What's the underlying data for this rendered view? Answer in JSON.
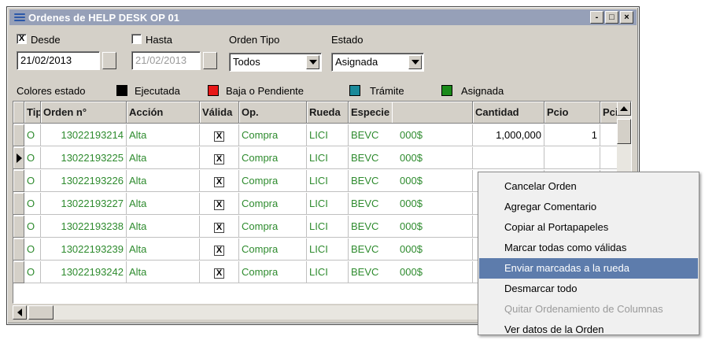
{
  "window": {
    "title": "Ordenes de HELP DESK OP 01",
    "icon": "stack-icon",
    "controls": [
      "-",
      "□",
      "×"
    ]
  },
  "filters": {
    "desde": {
      "label": "Desde",
      "checked": true,
      "check_mark": "X",
      "value": "21/02/2013"
    },
    "hasta": {
      "label": "Hasta",
      "checked": false,
      "value": "21/02/2013"
    },
    "orden_tipo": {
      "label": "Orden Tipo",
      "value": "Todos"
    },
    "estado": {
      "label": "Estado",
      "value": "Asignada"
    }
  },
  "legend": {
    "title": "Colores estado",
    "items": [
      {
        "label": "Ejecutada",
        "color": "#000000"
      },
      {
        "label": "Baja o Pendiente",
        "color": "#e81818"
      },
      {
        "label": "Trámite",
        "color": "#1a8a9a"
      },
      {
        "label": "Asignada",
        "color": "#1a8a1a"
      }
    ]
  },
  "grid": {
    "columns": [
      "Tipo",
      "Orden n°",
      "Acción",
      "Válida",
      "Op.",
      "Rueda",
      "Especie",
      "",
      "Cantidad",
      "Pcio",
      "Pcio"
    ],
    "rows": [
      {
        "tipo": "O",
        "orden": "13022193214",
        "accion": "Alta",
        "valida": "X",
        "op": "Compra",
        "rueda": "LICI",
        "especie": "BEVC",
        "moneda": "000$",
        "cantidad": "1,000,000",
        "pcio": "1",
        "current": false
      },
      {
        "tipo": "O",
        "orden": "13022193225",
        "accion": "Alta",
        "valida": "X",
        "op": "Compra",
        "rueda": "LICI",
        "especie": "BEVC",
        "moneda": "000$",
        "cantidad": "",
        "pcio": "",
        "current": true
      },
      {
        "tipo": "O",
        "orden": "13022193226",
        "accion": "Alta",
        "valida": "X",
        "op": "Compra",
        "rueda": "LICI",
        "especie": "BEVC",
        "moneda": "000$",
        "cantidad": "",
        "pcio": "",
        "current": false
      },
      {
        "tipo": "O",
        "orden": "13022193227",
        "accion": "Alta",
        "valida": "X",
        "op": "Compra",
        "rueda": "LICI",
        "especie": "BEVC",
        "moneda": "000$",
        "cantidad": "",
        "pcio": "",
        "current": false
      },
      {
        "tipo": "O",
        "orden": "13022193238",
        "accion": "Alta",
        "valida": "X",
        "op": "Compra",
        "rueda": "LICI",
        "especie": "BEVC",
        "moneda": "000$",
        "cantidad": "",
        "pcio": "",
        "current": false
      },
      {
        "tipo": "O",
        "orden": "13022193239",
        "accion": "Alta",
        "valida": "X",
        "op": "Compra",
        "rueda": "LICI",
        "especie": "BEVC",
        "moneda": "000$",
        "cantidad": "",
        "pcio": "",
        "current": false
      },
      {
        "tipo": "O",
        "orden": "13022193242",
        "accion": "Alta",
        "valida": "X",
        "op": "Compra",
        "rueda": "LICI",
        "especie": "BEVC",
        "moneda": "000$",
        "cantidad": "",
        "pcio": "",
        "current": false
      }
    ]
  },
  "context_menu": {
    "items": [
      {
        "label": "Cancelar Orden",
        "highlighted": false,
        "disabled": false
      },
      {
        "label": "Agregar Comentario",
        "highlighted": false,
        "disabled": false
      },
      {
        "label": "Copiar al Portapapeles",
        "highlighted": false,
        "disabled": false
      },
      {
        "label": "Marcar todas como válidas",
        "highlighted": false,
        "disabled": false
      },
      {
        "label": "Enviar marcadas a la rueda",
        "highlighted": true,
        "disabled": false
      },
      {
        "label": "Desmarcar todo",
        "highlighted": false,
        "disabled": false
      },
      {
        "label": "Quitar Ordenamiento de Columnas",
        "highlighted": false,
        "disabled": true
      },
      {
        "label": "Ver datos de la Orden",
        "highlighted": false,
        "disabled": false
      }
    ]
  },
  "colors": {
    "titlebar": "#96a0b8",
    "row_text": "#2e8b2e",
    "menu_highlight": "#5d7cac"
  }
}
